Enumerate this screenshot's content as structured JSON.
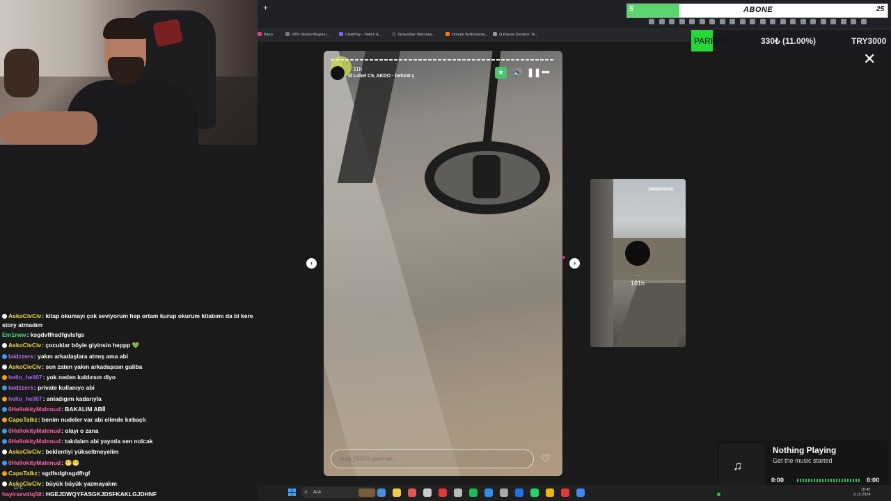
{
  "browser": {
    "new_tab": "+",
    "bookmarks": [
      {
        "label": "Blerp",
        "color": "#e0408a"
      },
      {
        "label": "OBS Studio Plugins |...",
        "color": "#7b7b7b"
      },
      {
        "label": "ChatPlay - Twitch &...",
        "color": "#8b5cf6"
      },
      {
        "label": "GravaStar Web-bas...",
        "color": "#444444"
      },
      {
        "label": "Donate ByNoGame...",
        "color": "#ff7a00"
      },
      {
        "label": "Q Klavye Dersleri: Te...",
        "color": "#999999"
      }
    ]
  },
  "overlay": {
    "abone_count": "5",
    "abone_label": "ABONE",
    "abone_goal": "25",
    "abone_progress": 0.2,
    "ticker_label": "PARRA:)",
    "ticker_change": "330₺ (11.00%)",
    "ticker_total": "TRY3000"
  },
  "story": {
    "username": ".",
    "time": "31h",
    "music": "Lvbel C5, AKDO · behzat ç",
    "star_icon": "★",
    "mute_icon": "🔊",
    "pause_icon": "❚❚",
    "more_icon": "•••",
    "reply_placeholder": "aras_9505'e yanıt ver...",
    "heart_icon": "♡",
    "prev_icon": "‹",
    "next_icon": "›",
    "close_icon": "✕"
  },
  "side_story": {
    "name": "...",
    "time": "181h",
    "tag": "Yaklaşan etkinlik"
  },
  "chat": [
    {
      "user": "AskoCivCiv",
      "color": "#f0d94a",
      "badge": "#ffffff",
      "text": ": kitap okumayı çok seviyorum hep ortam kurup okurum kitabımı da bi kere story atmadım",
      "wrap": true
    },
    {
      "user": "Em1rww",
      "color": "#3fe07a",
      "badge": "",
      "text": ": ksgdvflhsdfgvlsfgs"
    },
    {
      "user": "AskoCivCiv",
      "color": "#f0d94a",
      "badge": "#ffffff",
      "text": ": çocuklar böyle giyinsin heppp 💚"
    },
    {
      "user": "laidzzers",
      "color": "#c86cf0",
      "badge": "#3b9cf0",
      "text": ": yakın arkadaşlara atmış ama abi"
    },
    {
      "user": "AskoCivCiv",
      "color": "#f0d94a",
      "badge": "#ffffff",
      "text": ": sen zaten yakın arkadaşısın galiba"
    },
    {
      "user": "hello_hell07",
      "color": "#a565f5",
      "badge": "#f0a020",
      "text": ": yok neden kaldırsın diyo"
    },
    {
      "user": "laidzzers",
      "color": "#c86cf0",
      "badge": "#3b9cf0",
      "text": ": private kullanıyo abi"
    },
    {
      "user": "hello_hell07",
      "color": "#a565f5",
      "badge": "#f0a020",
      "text": ": anladıgım kadarıyla"
    },
    {
      "user": "0HellokityMahmud",
      "color": "#ff5fa8",
      "badge": "#3b9cf0",
      "text": ": BAKALIM ABİİ"
    },
    {
      "user": "CapoTalkz",
      "color": "#f0d94a",
      "badge": "#f0a020",
      "text": ": benim nudeler var abi elimde kırbaçlı"
    },
    {
      "user": "0HellokityMahmud",
      "color": "#ff5fa8",
      "badge": "#3b9cf0",
      "text": ": olayı o zana"
    },
    {
      "user": "0HellokityMahmud",
      "color": "#ff5fa8",
      "badge": "#3b9cf0",
      "text": ": takılalım abi yayınla sen nolcak"
    },
    {
      "user": "AskoCivCiv",
      "color": "#f0d94a",
      "badge": "#ffffff",
      "text": ": beklentiyi yükseltmeyelim"
    },
    {
      "user": "0HellokityMahmud",
      "color": "#ff5fa8",
      "badge": "#3b9cf0",
      "text": ": 😁😁"
    },
    {
      "user": "CapoTalkz",
      "color": "#f0d94a",
      "badge": "#f0a020",
      "text": ": sgdfsdghsgdfhgf"
    },
    {
      "user": "AskoCivCiv",
      "color": "#f0d94a",
      "badge": "#ffffff",
      "text": ": büyük büyük yazmayalım"
    },
    {
      "user": "hayirsevdiq58",
      "color": "#ff5fa8",
      "badge": "",
      "text": ": HGEJDWQYFASGKJDSFKAKLGJDHNF"
    }
  ],
  "music": {
    "title": "Nothing Playing",
    "subtitle": "Get the music started",
    "time_start": "0:00",
    "time_end": "0:00",
    "icon": "♫"
  },
  "taskbar": {
    "search_label": "Ara",
    "search_icon": "⌕",
    "weather": "11°C",
    "time": "18:42",
    "date": "2.12.2024",
    "apps": [
      "#7a5c3a",
      "#4a90d9",
      "#f2c94c",
      "#e55353",
      "#cccccc",
      "#e53935",
      "#bbbbbb",
      "#1db954",
      "#2d8cf0",
      "#aaaaaa",
      "#1a73e8",
      "#25d366",
      "#f2b705",
      "#e53935",
      "#4285f4"
    ]
  }
}
